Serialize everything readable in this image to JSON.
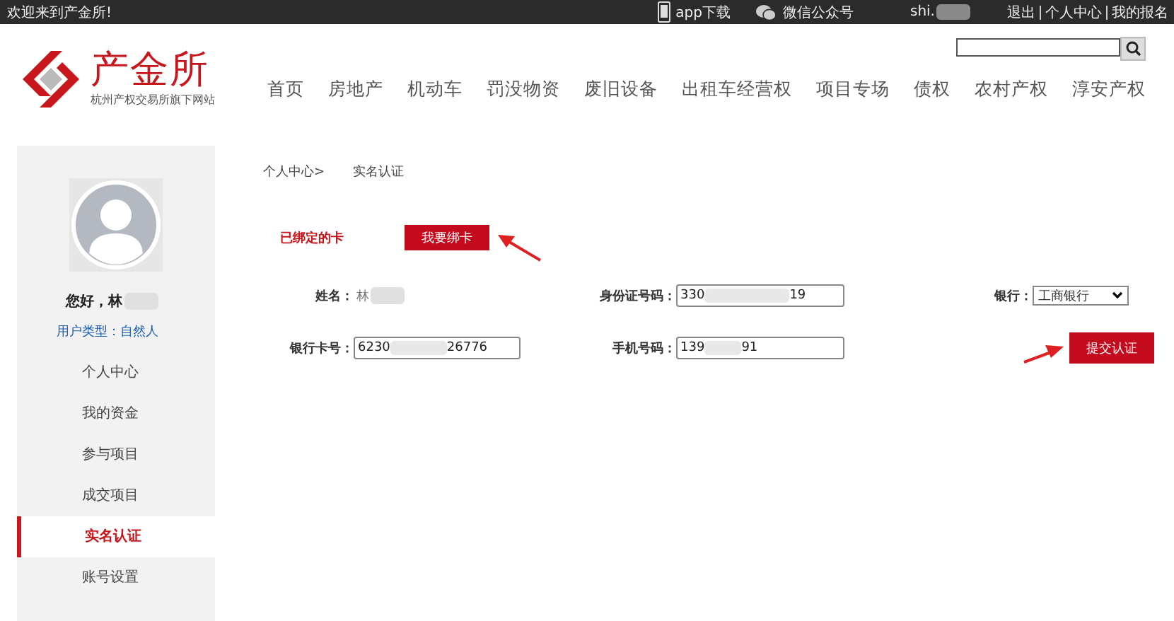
{
  "top_bar": {
    "welcome": "欢迎来到产金所!",
    "app_download": "app下载",
    "wechat": "微信公众号",
    "username": "shi.",
    "links": [
      {
        "label": "退出"
      },
      {
        "label": "个人中心"
      },
      {
        "label": "我的报名"
      }
    ]
  },
  "logo": {
    "name": "产金所",
    "subtitle": "杭州产权交易所旗下网站"
  },
  "nav": [
    {
      "label": "首页"
    },
    {
      "label": "房地产"
    },
    {
      "label": "机动车"
    },
    {
      "label": "罚没物资"
    },
    {
      "label": "废旧设备"
    },
    {
      "label": "出租车经营权"
    },
    {
      "label": "项目专场"
    },
    {
      "label": "债权"
    },
    {
      "label": "农村产权"
    },
    {
      "label": "淳安产权"
    }
  ],
  "sidebar": {
    "greeting": "您好，林",
    "user_type": "用户类型：自然人",
    "items": [
      {
        "label": "个人中心",
        "selected": false
      },
      {
        "label": "我的资金",
        "selected": false
      },
      {
        "label": "参与项目",
        "selected": false
      },
      {
        "label": "成交项目",
        "selected": false
      },
      {
        "label": "实名认证",
        "selected": true
      },
      {
        "label": "账号设置",
        "selected": false
      }
    ]
  },
  "breadcrumb": [
    {
      "label": "个人中心>"
    },
    {
      "label": "实名认证"
    }
  ],
  "card_tab": {
    "label": "已绑定的卡",
    "button": "我要绑卡"
  },
  "form": {
    "name": {
      "label": "姓名：",
      "value": "林"
    },
    "id_number": {
      "label": "身份证号码：",
      "value_start": "330",
      "value_end": "19"
    },
    "bank": {
      "label": "银行：",
      "value": "工商银行"
    },
    "card_number": {
      "label": "银行卡号：",
      "value_start": "6230",
      "value_end": "26776"
    },
    "phone": {
      "label": "手机号码：",
      "value_start": "139",
      "value_end": "91"
    },
    "submit": "提交认证"
  }
}
